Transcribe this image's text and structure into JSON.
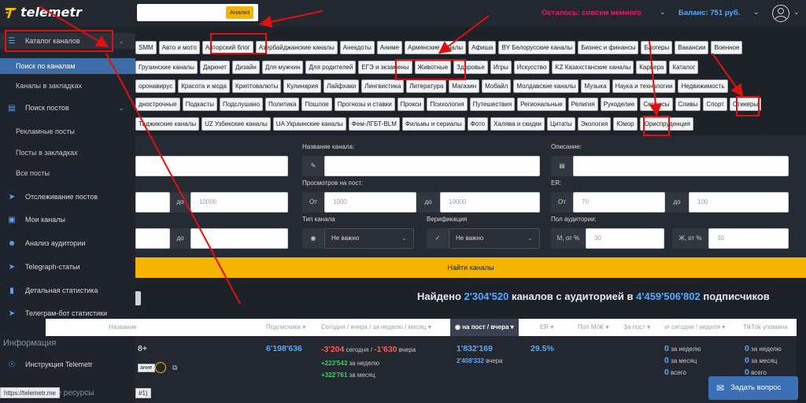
{
  "header": {
    "logo_text": "telemetr",
    "analyze_label": "Анализ",
    "remaining": "Осталось: совсем немного",
    "balance": "Баланс: 751 руб."
  },
  "sidebar": {
    "catalog": "Каталог каналов",
    "search_channels": "Поиск по каналам",
    "bookmarked_channels": "Каналы в закладках",
    "search_posts": "Поиск постов",
    "ad_posts": "Рекламные посты",
    "bookmarked_posts": "Посты в закладках",
    "all_posts": "Все посты",
    "tracking_posts": "Отслеживание постов",
    "my_channels": "Мои каналы",
    "audience_analysis": "Анализ аудитории",
    "telegraph": "Telegraph-статьи",
    "detailed_stats": "Детальная статистика",
    "bot_stats": "Телеграм-бот статистики",
    "info_section": "Информация",
    "instruction": "Инструкция Telemetr",
    "resources": "...е ресурсы",
    "url_tip": "https://telemetr.me"
  },
  "tags": {
    "row1": [
      "SMM",
      "Авто и мото",
      "Авторский блог",
      "Азербайджанские каналы",
      "Анекдоты",
      "Аниме",
      "Армянские каналы",
      "Афиша",
      "BY Белорусские каналы",
      "Бизнес и финансы",
      "Блогеры",
      "Вакансии",
      "Военное"
    ],
    "row2": [
      "Грузинские каналы",
      "Даркнет",
      "Дизайн",
      "Для мужчин",
      "Для родителей",
      "ЕГЭ и экзамены",
      "Животные",
      "Здоровье",
      "Игры",
      "Искусство",
      "KZ Казахстанские каналы",
      "Карьера",
      "Каталог"
    ],
    "row3": [
      "оронавирус",
      "Красота и мода",
      "Криптовалюты",
      "Кулинария",
      "Лайфхаки",
      "Лингвистика",
      "Литература",
      "Магазин",
      "Мобайл",
      "Молдавские каналы",
      "Музыка",
      "Наука и технологии",
      "Недвижимость"
    ],
    "row4": [
      "днострочные",
      "Подкасты",
      "Подслушано",
      "Политика",
      "Пошлое",
      "Прогнозы и ставки",
      "Прокси",
      "Психология",
      "Путешествия",
      "Региональные",
      "Религия",
      "Рукоделие",
      "Сервисы",
      "Сливы",
      "Спорт",
      "Стикеры"
    ],
    "row5": [
      "Таджикские каналы",
      "UZ Узбекские каналы",
      "UA Украинские каналы",
      "Фем-ЛГБТ-BLM",
      "Фильмы и сериалы",
      "Фото",
      "Халява и скидки",
      "Цитаты",
      "Экология",
      "Юмор",
      "Юриспруденция"
    ]
  },
  "filters": {
    "channel_name_label": "Название канала:",
    "description_label": "Описание:",
    "views_label": "Просмотров на пост:",
    "er_label": "ER:",
    "channel_type_label": "Тип канала",
    "verification_label": "Верификация",
    "audience_gender_label": "Пол аудитории:",
    "from": "От",
    "to": "до",
    "subs_to_placeholder": "10000",
    "views_from_placeholder": "1000",
    "views_to_placeholder": "10000",
    "er_from_placeholder": "70",
    "er_to_placeholder": "100",
    "channel_type_value": "Не важно",
    "verification_value": "Не важно",
    "male_label": "М, от %",
    "male_placeholder": "30",
    "female_label": "Ж, от %",
    "female_placeholder": "30",
    "find_button": "Найти каналы"
  },
  "summary": {
    "found_prefix": "Найдено",
    "channels_count": "2'304'520",
    "channels_mid": "каналов с аудиторией в",
    "audience": "4'459'506'802",
    "suffix": "подписчиков"
  },
  "table": {
    "columns": {
      "name": "Название",
      "subscribers": "Подписчики",
      "growth": "Сегодня / вчера / за неделю / месяц",
      "views": "на пост / вчера",
      "er": "ER",
      "gender": "Пол М/Ж",
      "per_post": "За пост",
      "mentions": "сегодня / неделя",
      "tiktok": "TikTok упомина"
    },
    "row": {
      "name_partial": "8+",
      "badge": "ание",
      "tooltip_partial": "#1)",
      "subscribers": "6'198'636",
      "today": "-3'204",
      "today_label": "сегодня /",
      "yesterday": "-1'630",
      "yesterday_label": "вчера",
      "week": "+223'543",
      "week_label": "за неделю",
      "month": "+322'761",
      "month_label": "за месяц",
      "views_post": "1'832'169",
      "views_yesterday": "2'408'332",
      "views_yesterday_label": "вчера",
      "er": "29.5%",
      "mentions_week": "0",
      "mentions_week_label": "за неделю",
      "mentions_month": "0",
      "mentions_month_label": "за месяц",
      "mentions_total": "0",
      "mentions_total_label": "всего",
      "tiktok_week": "0",
      "tiktok_week_label": "за неделю",
      "tiktok_month": "0",
      "tiktok_month_label": "за месяц",
      "tiktok_total": "0",
      "tiktok_total_label": "всего"
    }
  },
  "support": {
    "ask_label": "Задать вопрос"
  },
  "colors": {
    "accent": "#f4b400",
    "link": "#5aa8ff",
    "alert": "#e91e63",
    "annotation": "#e01010"
  }
}
